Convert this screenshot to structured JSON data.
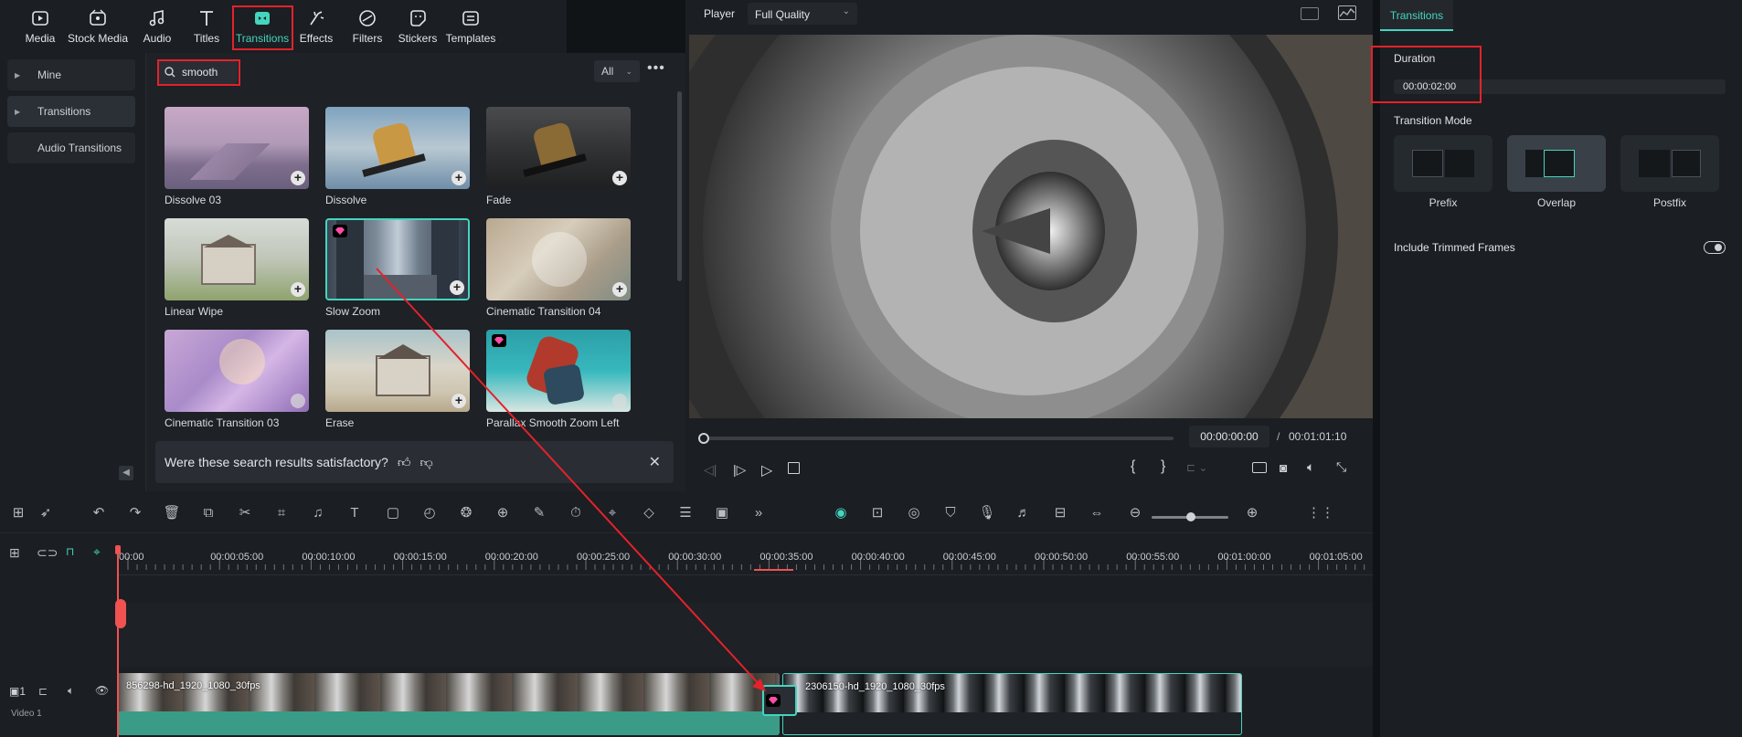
{
  "toolbar": {
    "items": [
      {
        "label": "Media",
        "icon": "media-icon"
      },
      {
        "label": "Stock Media",
        "icon": "stock-media-icon"
      },
      {
        "label": "Audio",
        "icon": "audio-icon"
      },
      {
        "label": "Titles",
        "icon": "titles-icon"
      },
      {
        "label": "Transitions",
        "icon": "transitions-icon",
        "active": true
      },
      {
        "label": "Effects",
        "icon": "effects-icon"
      },
      {
        "label": "Filters",
        "icon": "filters-icon"
      },
      {
        "label": "Stickers",
        "icon": "stickers-icon"
      },
      {
        "label": "Templates",
        "icon": "templates-icon"
      }
    ]
  },
  "sidebar": {
    "items": [
      {
        "label": "Mine"
      },
      {
        "label": "Transitions"
      },
      {
        "label": "Audio Transitions"
      }
    ]
  },
  "search": {
    "value": "smooth",
    "filter": "All"
  },
  "transitions": [
    {
      "label": "Dissolve 03",
      "action": "add"
    },
    {
      "label": "Dissolve",
      "action": "add"
    },
    {
      "label": "Fade",
      "action": "add"
    },
    {
      "label": "Linear Wipe",
      "action": "add"
    },
    {
      "label": "Slow Zoom",
      "action": "add",
      "premium": true,
      "selected": true
    },
    {
      "label": "Cinematic Transition 04",
      "action": "add"
    },
    {
      "label": "Cinematic Transition 03",
      "action": "download"
    },
    {
      "label": "Erase",
      "action": "add"
    },
    {
      "label": "Parallax Smooth Zoom Left",
      "action": "download",
      "premium": true
    }
  ],
  "feedback": {
    "question": "Were these search results satisfactory?"
  },
  "player": {
    "label": "Player",
    "quality": "Full Quality",
    "current_time": "00:00:00:00",
    "separator": "/",
    "total_time": "00:01:01:10",
    "progress": 0
  },
  "properties": {
    "tab": "Transitions",
    "duration_label": "Duration",
    "duration_value": "00:00:02:00",
    "mode_label": "Transition Mode",
    "modes": [
      {
        "label": "Prefix"
      },
      {
        "label": "Overlap",
        "selected": true
      },
      {
        "label": "Postfix"
      }
    ],
    "trimmed_label": "Include Trimmed Frames",
    "trimmed_on": false
  },
  "timeline": {
    "ruler": [
      "00:00",
      "00:00:05:00",
      "00:00:10:00",
      "00:00:15:00",
      "00:00:20:00",
      "00:00:25:00",
      "00:00:30:00",
      "00:00:35:00",
      "00:00:40:00",
      "00:00:45:00",
      "00:00:50:00",
      "00:00:55:00",
      "00:01:00:00",
      "00:01:05:00"
    ],
    "track_number": "1",
    "track_name": "Video 1",
    "clip1": "856298-hd_1920_1080_30fps",
    "clip2": "2306150-hd_1920_1080_30fps"
  },
  "colors": {
    "accent": "#44d5bf",
    "highlight": "#e3222b",
    "playhead": "#f05252"
  }
}
